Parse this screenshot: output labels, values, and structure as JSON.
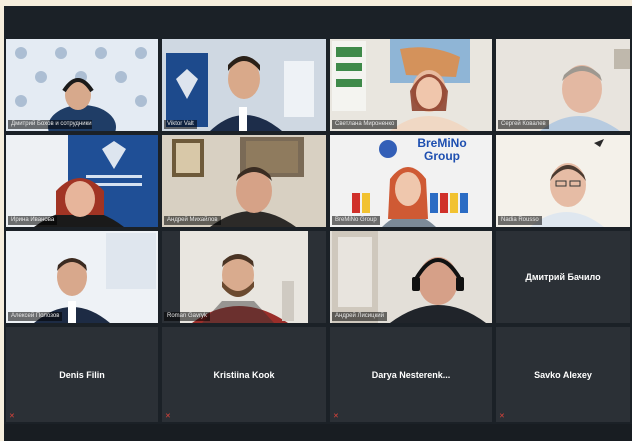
{
  "meeting": {
    "tiles": [
      {
        "kind": "video",
        "label": "Дмитрий Бохов и сотрудники"
      },
      {
        "kind": "video",
        "label": "Viktor Valt"
      },
      {
        "kind": "video",
        "label": "Светлана Мироненко"
      },
      {
        "kind": "video",
        "label": "Сергей Ковалев"
      },
      {
        "kind": "video",
        "label": "Ирина Иванова"
      },
      {
        "kind": "video",
        "label": "Андрей Михайлов"
      },
      {
        "kind": "video",
        "label": "BreMiNo Group",
        "banner": "BreMiNo",
        "banner2": "Group"
      },
      {
        "kind": "video",
        "label": "Nadia Rousso"
      },
      {
        "kind": "video",
        "label": "Алексей Полозов"
      },
      {
        "kind": "video",
        "label": "Roman Gavryk"
      },
      {
        "kind": "video",
        "label": "Андрей Лисицкий"
      },
      {
        "kind": "name",
        "name": "Дмитрий Бачило"
      },
      {
        "kind": "name",
        "name": "Denis Filin"
      },
      {
        "kind": "name",
        "name": "Kristiina Kook"
      },
      {
        "kind": "name",
        "name": "Darya Nesterenk..."
      },
      {
        "kind": "name",
        "name": "Savko Alexey"
      }
    ],
    "mute_glyph": "✕"
  }
}
